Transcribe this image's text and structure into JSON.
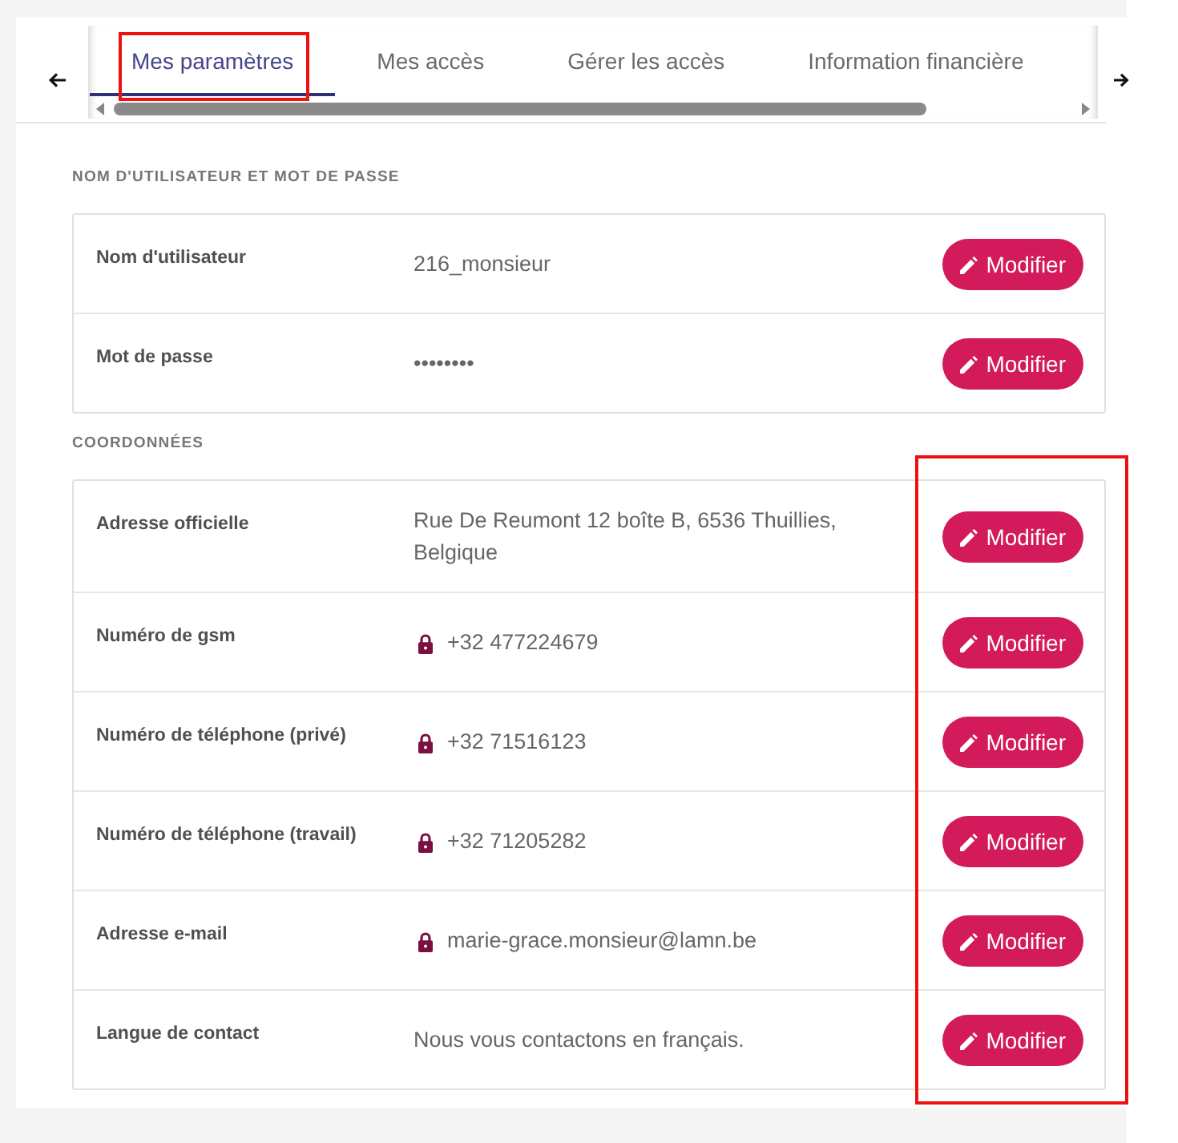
{
  "tabs": [
    {
      "label": "Mes paramètres",
      "selected": true,
      "outlined": true
    },
    {
      "label": "Mes accès",
      "selected": false,
      "outlined": false
    },
    {
      "label": "Gérer les accès",
      "selected": false,
      "outlined": false
    },
    {
      "label": "Information financière",
      "selected": false,
      "outlined": false
    }
  ],
  "sections": [
    {
      "heading": "NOM D'UTILISATEUR ET MOT DE PASSE",
      "buttons_outlined": false,
      "rows": [
        {
          "label": "Nom d'utilisateur",
          "value": "216_monsieur",
          "locked": false,
          "button": "Modifier"
        },
        {
          "label": "Mot de passe",
          "value": "••••••••",
          "locked": false,
          "button": "Modifier"
        }
      ]
    },
    {
      "heading": "COORDONNÉES",
      "buttons_outlined": true,
      "rows": [
        {
          "label": "Adresse officielle",
          "value": "Rue De Reumont 12 boîte B, 6536 Thuillies, Belgique",
          "locked": false,
          "button": "Modifier"
        },
        {
          "label": "Numéro de gsm",
          "value": "+32 477224679",
          "locked": true,
          "button": "Modifier"
        },
        {
          "label": "Numéro de téléphone (privé)",
          "value": "+32 71516123",
          "locked": true,
          "button": "Modifier"
        },
        {
          "label": "Numéro de téléphone (travail)",
          "value": "+32 71205282",
          "locked": true,
          "button": "Modifier"
        },
        {
          "label": "Adresse e-mail",
          "value": "marie-grace.monsieur@lamn.be",
          "locked": true,
          "button": "Modifier"
        },
        {
          "label": "Langue de contact",
          "value": "Nous vous contactons en français.",
          "locked": false,
          "button": "Modifier"
        }
      ]
    }
  ]
}
